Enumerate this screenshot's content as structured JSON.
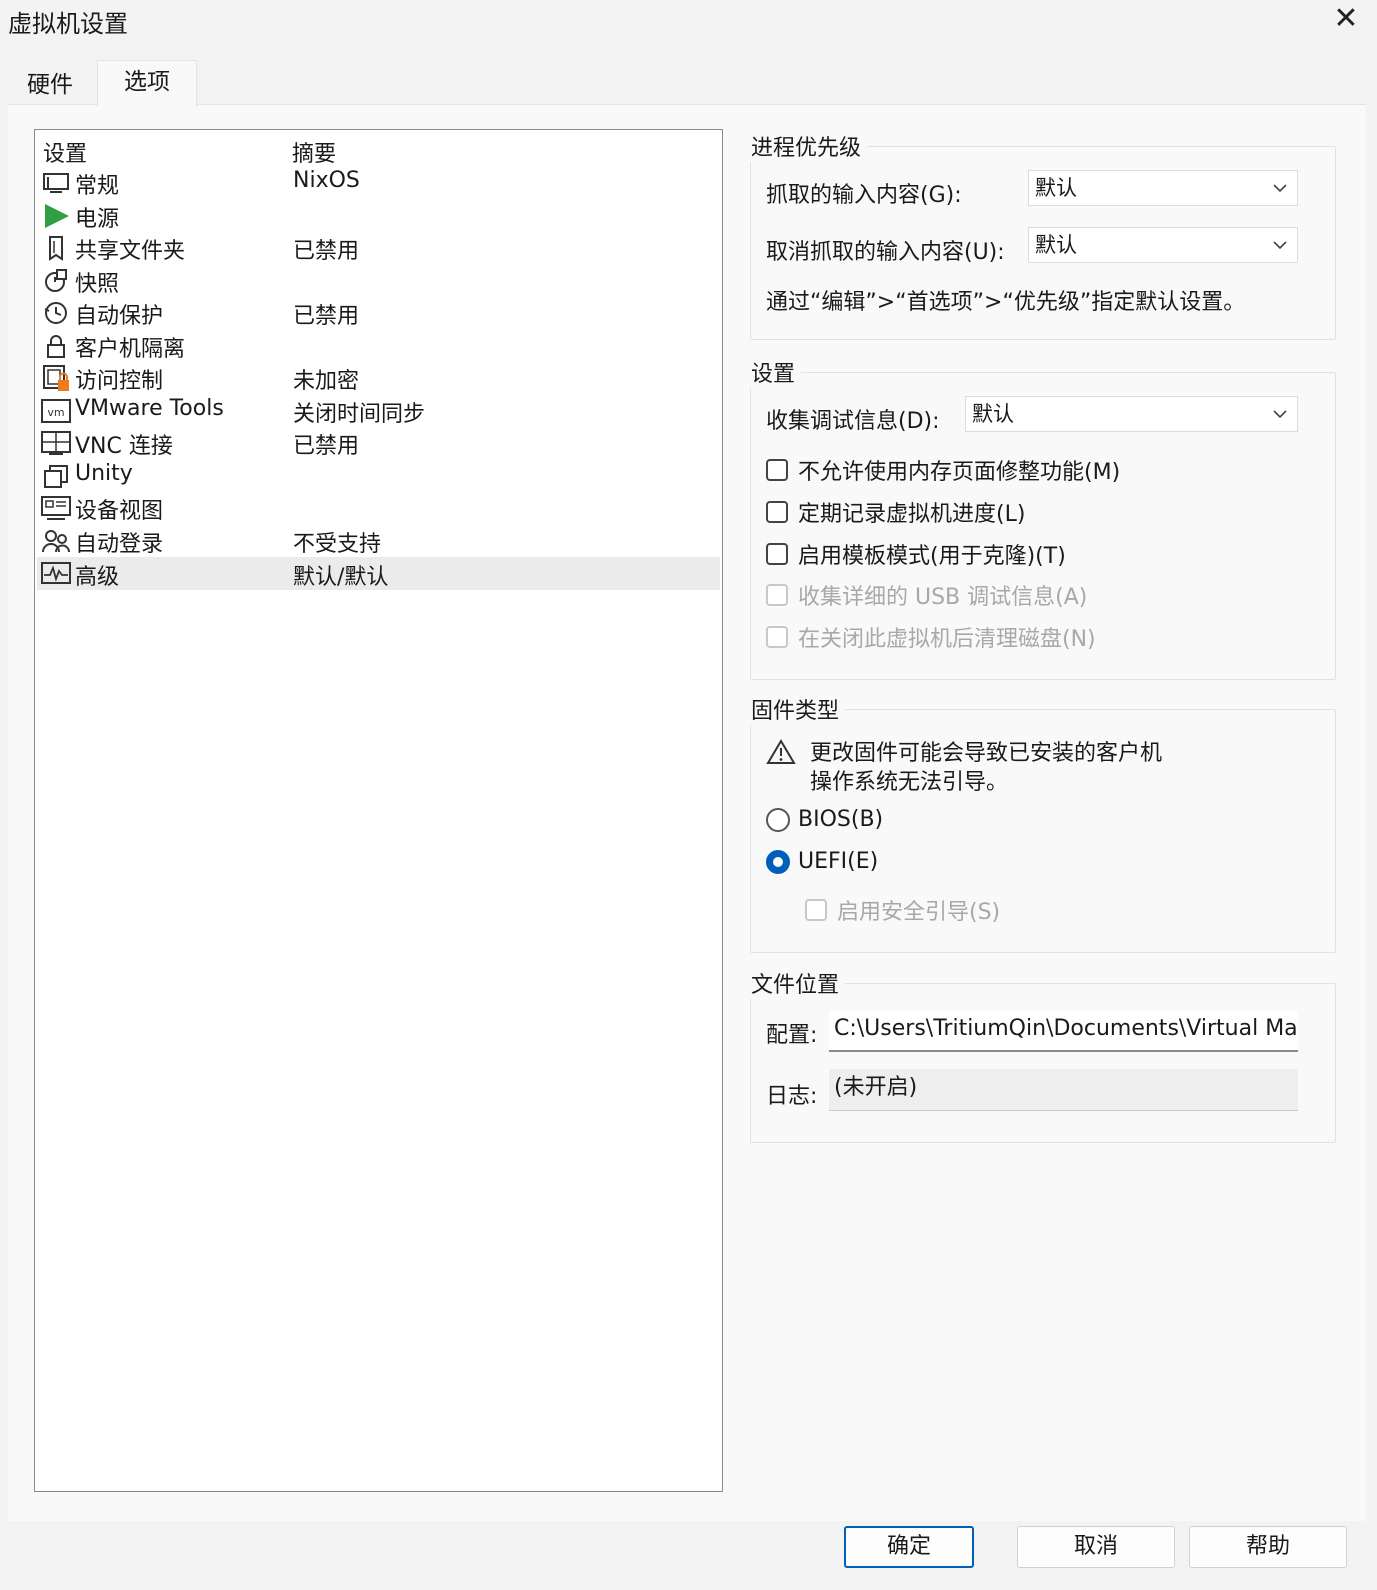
{
  "window": {
    "title": "虚拟机设置",
    "close_symbol": "✕"
  },
  "tabs": [
    {
      "label": "硬件"
    },
    {
      "label": "选项"
    }
  ],
  "settings_list": {
    "col_setting": "设置",
    "col_summary": "摘要",
    "rows": [
      {
        "name": "常规",
        "summary": "NixOS",
        "icon": "monitor-icon"
      },
      {
        "name": "电源",
        "summary": "",
        "icon": "power-play-icon"
      },
      {
        "name": "共享文件夹",
        "summary": "已禁用",
        "icon": "shared-folder-icon"
      },
      {
        "name": "快照",
        "summary": "",
        "icon": "snapshot-icon"
      },
      {
        "name": "自动保护",
        "summary": "已禁用",
        "icon": "clock-icon"
      },
      {
        "name": "客户机隔离",
        "summary": "",
        "icon": "lock-icon"
      },
      {
        "name": "访问控制",
        "summary": "未加密",
        "icon": "access-control-icon"
      },
      {
        "name": "VMware Tools",
        "summary": "关闭时间同步",
        "icon": "vm-icon"
      },
      {
        "name": "VNC 连接",
        "summary": "已禁用",
        "icon": "vnc-icon"
      },
      {
        "name": "Unity",
        "summary": "",
        "icon": "unity-icon"
      },
      {
        "name": "设备视图",
        "summary": "",
        "icon": "device-view-icon"
      },
      {
        "name": "自动登录",
        "summary": "不受支持",
        "icon": "users-icon"
      },
      {
        "name": "高级",
        "summary": "默认/默认",
        "icon": "advanced-pulse-icon"
      }
    ],
    "selected": "高级"
  },
  "process_priority": {
    "legend": "进程优先级",
    "grabbed_label": "抓取的输入内容(G):",
    "grabbed_value": "默认",
    "ungrabbed_label": "取消抓取的输入内容(U):",
    "ungrabbed_value": "默认",
    "hint": "通过“编辑”>“首选项”>“优先级”指定默认设置。"
  },
  "settings_group": {
    "legend": "设置",
    "debug_label": "收集调试信息(D):",
    "debug_value": "默认",
    "cb1": "不允许使用内存页面修整功能(M)",
    "cb2": "定期记录虚拟机进度(L)",
    "cb3": "启用模板模式(用于克隆)(T)",
    "cb4": "收集详细的 USB 调试信息(A)",
    "cb5": "在关闭此虚拟机后清理磁盘(N)"
  },
  "firmware": {
    "legend": "固件类型",
    "warning_line1": "更改固件可能会导致已安装的客户机",
    "warning_line2": "操作系统无法引导。",
    "bios": "BIOS(B)",
    "uefi": "UEFI(E)",
    "selected": "UEFI(E)",
    "secure_boot": "启用安全引导(S)"
  },
  "file_location": {
    "legend": "文件位置",
    "config_label": "配置:",
    "config_value": "C:\\Users\\TritiumQin\\Documents\\Virtual Macl",
    "log_label": "日志:",
    "log_value": "(未开启)"
  },
  "buttons": {
    "ok": "确定",
    "cancel": "取消",
    "help": "帮助"
  },
  "colors": {
    "accent": "#005fb8",
    "power_green": "#2ea043",
    "lock_orange": "#f07b1d"
  }
}
